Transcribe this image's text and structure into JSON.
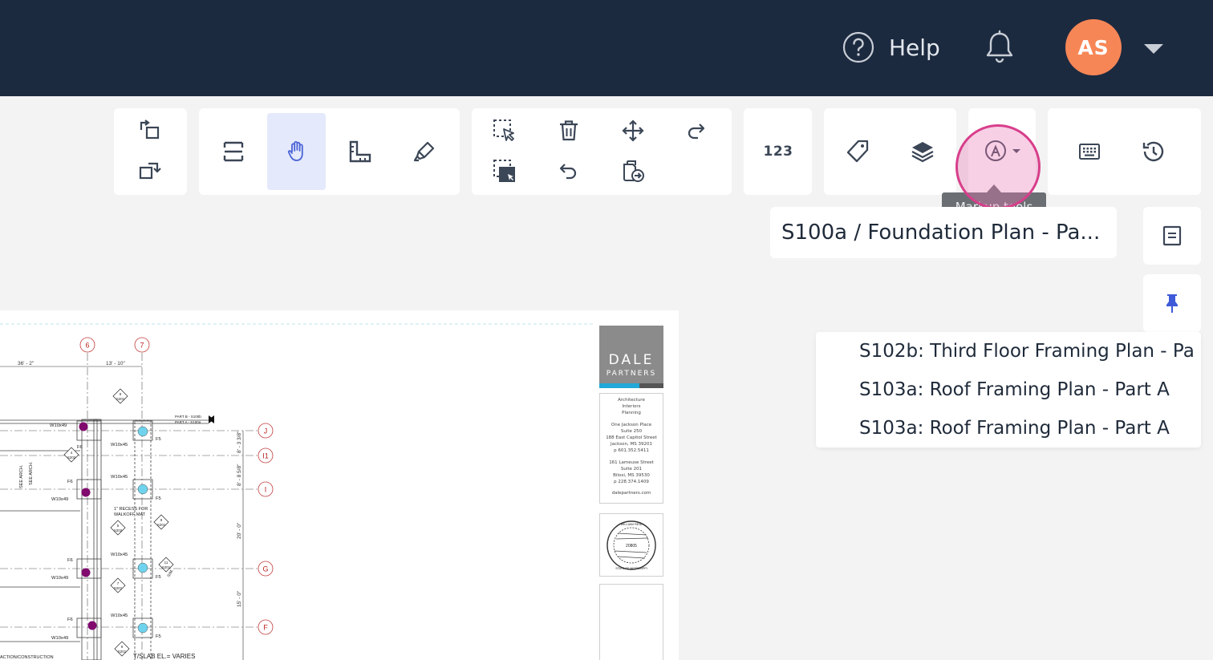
{
  "header": {
    "help_label": "Help",
    "avatar_initials": "AS",
    "background_color": "#1c2a40",
    "avatar_color": "#f78656"
  },
  "toolbar": {
    "count_label": "123",
    "tooltip": "Markup tools",
    "active_tool": "pan-hand"
  },
  "sheet": {
    "current_title": "S100a / Foundation Plan - Pa..."
  },
  "dropdown": {
    "items": [
      "S102b: Third Floor Framing Plan - Pa...",
      "S103a: Roof Framing Plan - Part A",
      "S103a: Roof Framing Plan - Part A"
    ]
  },
  "drawing": {
    "grid_columns": [
      "6",
      "7"
    ],
    "grid_rows": [
      "J",
      "I1",
      "I",
      "G",
      "F"
    ],
    "dimensions": [
      "36' - 2\"",
      "13' - 10\"",
      "8' - 3 3/8\"",
      "8' - 8 5/8\"",
      "20' - 0\"",
      "15' - 0\""
    ],
    "beam_labels": [
      "W10x49",
      "W10x45",
      "W10x45",
      "W10x49",
      "W10x45",
      "W10x49",
      "W10x45",
      "W10x49"
    ],
    "footing_labels": [
      "F5",
      "F6",
      "F5",
      "F6",
      "F5",
      "F6",
      "F5"
    ],
    "notes": [
      "PART B - S100b",
      "PART A - S100a",
      "SEE ARCH.",
      "SEE ARCH.",
      "1\" RECESS FOR",
      "WALKOFF MAT",
      "T/SLAB EL.= VARIES",
      "ACTION/CONSTRUCTION",
      "SIM."
    ],
    "section_tags": [
      {
        "num": "9",
        "sheet": "S201"
      },
      {
        "num": "4",
        "sheet": "S202"
      },
      {
        "num": "9",
        "sheet": "S201"
      },
      {
        "num": "5",
        "sheet": "S202"
      },
      {
        "num": "11",
        "sheet": "S201"
      },
      {
        "num": "7",
        "sheet": "S201"
      },
      {
        "num": "9",
        "sheet": "S201"
      }
    ],
    "title_block": {
      "firm": "DALE",
      "firm_sub": "PARTNERS",
      "services": [
        "Architecture",
        "Interiors",
        "Planning"
      ],
      "office1": [
        "One Jackson Place",
        "Suite 250",
        "188 East Capitol Street",
        "Jackson, MS 39201",
        "p 601.352.5411"
      ],
      "office2": [
        "161 Lameuse Street",
        "Suite 201",
        "Biloxi, MS 39530",
        "p 228.374.1409"
      ],
      "website": "dalepartners.com",
      "seal_name": "WILLIAM REID",
      "seal_number": "20805",
      "seal_state": "STATE OF MISSISSIPPI"
    }
  }
}
